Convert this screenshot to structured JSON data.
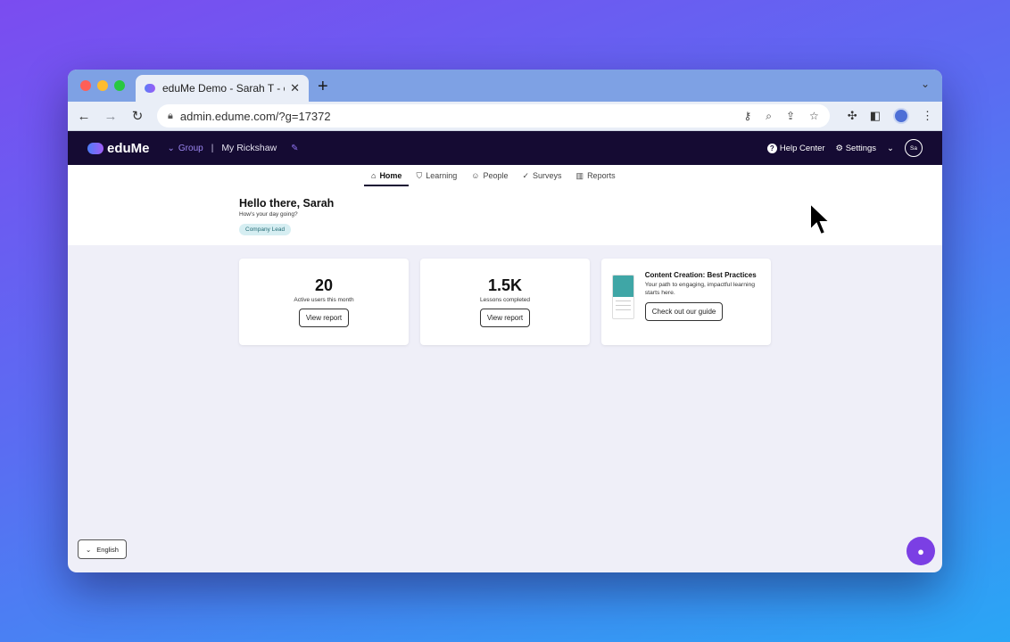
{
  "browser": {
    "tab_title": "eduMe Demo - Sarah T - eduM",
    "url": "admin.edume.com/?g=17372"
  },
  "app": {
    "logo_text": "eduMe",
    "group_label": "Group",
    "separator": "|",
    "org_name": "My Rickshaw",
    "help_label": "Help Center",
    "settings_label": "Settings",
    "avatar_initials": "Sa"
  },
  "nav": {
    "items": [
      {
        "label": "Home",
        "active": true
      },
      {
        "label": "Learning"
      },
      {
        "label": "People"
      },
      {
        "label": "Surveys"
      },
      {
        "label": "Reports"
      }
    ]
  },
  "greeting": {
    "title": "Hello there, Sarah",
    "subtitle": "How's your day going?",
    "role_badge": "Company Lead"
  },
  "cards": {
    "users": {
      "value": "20",
      "label": "Active users this month",
      "button": "View report"
    },
    "lessons": {
      "value": "1.5K",
      "label": "Lessons completed",
      "button": "View report"
    },
    "guide": {
      "title": "Content Creation: Best Practices",
      "desc": "Your path to engaging, impactful learning starts here.",
      "button": "Check out our guide"
    }
  },
  "footer": {
    "language": "English"
  }
}
